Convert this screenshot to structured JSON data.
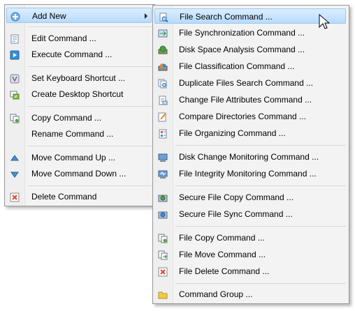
{
  "menu1": {
    "items": [
      {
        "label": "Add New",
        "icon": "plus-icon",
        "submenu": true
      },
      {
        "label": "Edit Command ...",
        "icon": "edit-icon"
      },
      {
        "label": "Execute Command ...",
        "icon": "play-icon"
      },
      {
        "label": "Set Keyboard Shortcut ...",
        "icon": "keyboard-icon"
      },
      {
        "label": "Create Desktop Shortcut",
        "icon": "desktop-shortcut-icon"
      },
      {
        "label": "Copy Command ...",
        "icon": "copy-icon"
      },
      {
        "label": "Rename Command ...",
        "icon": ""
      },
      {
        "label": "Move Command Up ...",
        "icon": "triangle-up-icon"
      },
      {
        "label": "Move Command Down ...",
        "icon": "triangle-down-icon"
      },
      {
        "label": "Delete Command",
        "icon": "delete-icon"
      }
    ]
  },
  "menu2": {
    "items": [
      {
        "label": "File Search Command ...",
        "icon": "file-search-icon"
      },
      {
        "label": "File Synchronization Command ...",
        "icon": "file-sync-icon"
      },
      {
        "label": "Disk Space Analysis Command ...",
        "icon": "disk-space-icon"
      },
      {
        "label": "File Classification Command ...",
        "icon": "file-classification-icon"
      },
      {
        "label": "Duplicate Files Search Command ...",
        "icon": "duplicate-search-icon"
      },
      {
        "label": "Change File Attributes Command ...",
        "icon": "file-attributes-icon"
      },
      {
        "label": "Compare Directories Command ...",
        "icon": "compare-dirs-icon"
      },
      {
        "label": "File Organizing Command ...",
        "icon": "file-organize-icon"
      },
      {
        "label": "Disk Change Monitoring Command ...",
        "icon": "disk-monitor-icon"
      },
      {
        "label": "File Integrity Monitoring Command ...",
        "icon": "integrity-monitor-icon"
      },
      {
        "label": "Secure File Copy Command ...",
        "icon": "secure-copy-icon"
      },
      {
        "label": "Secure File Sync Command ...",
        "icon": "secure-sync-icon"
      },
      {
        "label": "File Copy Command ...",
        "icon": "file-copy-icon"
      },
      {
        "label": "File Move Command ...",
        "icon": "file-move-icon"
      },
      {
        "label": "File Delete Command ...",
        "icon": "file-delete-icon"
      },
      {
        "label": "Command Group ...",
        "icon": "folder-icon"
      }
    ]
  },
  "colors": {
    "highlight": "#cfe6fd",
    "menu_bg": "#f3f3f3"
  }
}
